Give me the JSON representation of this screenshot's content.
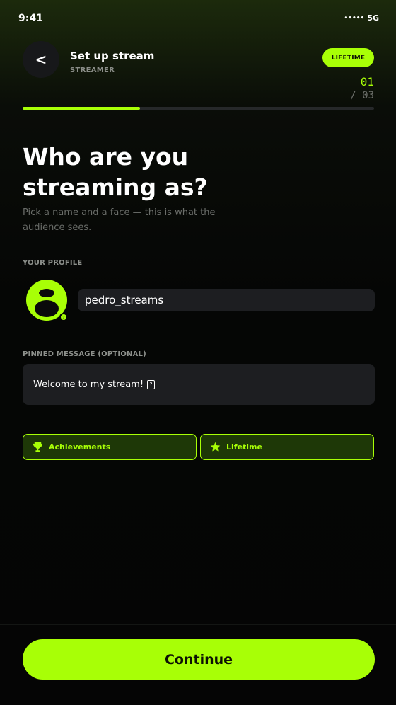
{
  "status_bar": {
    "time": "9:41",
    "signal": "•••••",
    "network": "5G"
  },
  "header": {
    "back_label": "<",
    "title": "Set up stream",
    "subtitle": "STREAMER",
    "badge": "LIFETIME",
    "step_current": "01",
    "step_total": "/ 03"
  },
  "progress": {
    "fraction": 0.333
  },
  "main": {
    "headline": "Who are you streaming as?",
    "subtext": "Pick a name and a face — this is what the audience sees.",
    "profile_label": "YOUR PROFILE",
    "username": "pedro_streams",
    "pinned_label": "PINNED MESSAGE (OPTIONAL)",
    "pinned_message": "Welcome to my stream!"
  },
  "chips": [
    {
      "label": "Achievements",
      "icon": "trophy-icon"
    },
    {
      "label": "Lifetime",
      "icon": "star-icon"
    }
  ],
  "footer": {
    "continue_label": "Continue"
  },
  "colors": {
    "accent": "#a8ff06",
    "surface": "#1d1e21",
    "background": "#050505"
  }
}
